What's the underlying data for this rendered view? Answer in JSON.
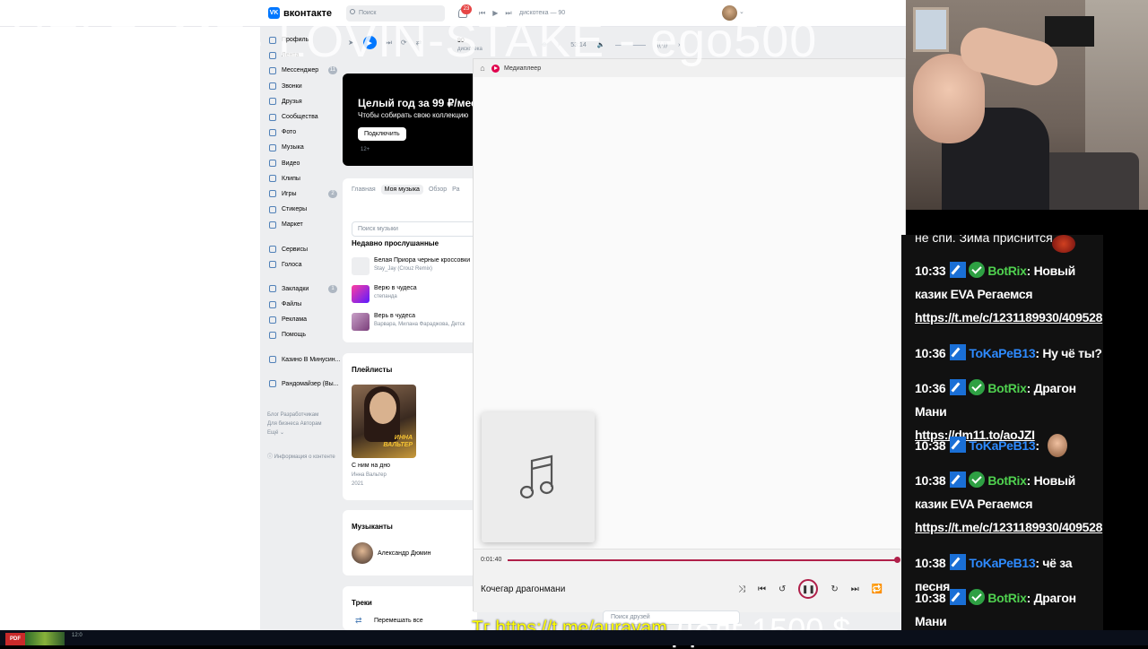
{
  "vk": {
    "brand": "вконтакте",
    "search_placeholder": "Поиск",
    "notif_count": "23",
    "mini_track": "дискотека — 90",
    "nav": [
      {
        "label": "Профиль",
        "badge": ""
      },
      {
        "label": "Лента",
        "badge": ""
      },
      {
        "label": "Мессенджер",
        "badge": "11"
      },
      {
        "label": "Звонки",
        "badge": ""
      },
      {
        "label": "Друзья",
        "badge": ""
      },
      {
        "label": "Сообщества",
        "badge": ""
      },
      {
        "label": "Фото",
        "badge": ""
      },
      {
        "label": "Музыка",
        "badge": ""
      },
      {
        "label": "Видео",
        "badge": ""
      },
      {
        "label": "Клипы",
        "badge": ""
      },
      {
        "label": "Игры",
        "badge": "2"
      },
      {
        "label": "Стикеры",
        "badge": ""
      },
      {
        "label": "Маркет",
        "badge": ""
      },
      {
        "label": "Сервисы",
        "badge": ""
      },
      {
        "label": "Голоса",
        "badge": ""
      },
      {
        "label": "Закладки",
        "badge": "1"
      },
      {
        "label": "Файлы",
        "badge": ""
      },
      {
        "label": "Реклама",
        "badge": ""
      },
      {
        "label": "Помощь",
        "badge": ""
      },
      {
        "label": "Казино В Минусин...",
        "badge": ""
      },
      {
        "label": "Рандомайзер (Вы...",
        "badge": ""
      }
    ],
    "footer": [
      "Блог  Разработчикам",
      "Для бизнеса  Авторам",
      "Ещё ⌄"
    ],
    "info": "Информация о контенте",
    "player": {
      "track_top": "90",
      "track_artist": "дискотека",
      "time": "53:14"
    },
    "promo": {
      "title": "Целый год за 99 ₽/мес",
      "subtitle": "Чтобы собирать свою коллекцию",
      "button": "Подключить",
      "age": "12+"
    },
    "music": {
      "tabs": [
        "Главная",
        "Моя музыка",
        "Обзор",
        "Ра"
      ],
      "search_placeholder": "Поиск музыки",
      "recent_title": "Недавно прослушанные",
      "recent": [
        {
          "title": "Белая Приора черные кроссовки",
          "artist": "Stay_Jay (Crouz Remix)"
        },
        {
          "title": "Верю в чудеса",
          "artist": "степанда"
        },
        {
          "title": "Верь в чудеса",
          "artist": "Варвара, Милана Фараджова, Детск"
        }
      ],
      "playlists_title": "Плейлисты",
      "playlist": {
        "cover_text_1": "ИННА",
        "cover_text_2": "ВАЛЬТЕР",
        "title": "С ним на дно",
        "artist": "Инна Вальтер",
        "year": "2021"
      },
      "musicians_title": "Музыканты",
      "musician": "Александр Дюмин",
      "tracks_title": "Треки",
      "shuffle_label": "Перемешать все"
    },
    "friends_search": "Поиск друзей"
  },
  "media_player": {
    "app_name": "Медиаплеер",
    "elapsed": "0:01:40",
    "progress_fraction": 0.99,
    "song_title": "Кочегар драгонмани",
    "accent": "#b0204a"
  },
  "overlay": {
    "help_text": "HELP- ME- LOVIN-STAKE - ego500",
    "tg_link": "Тг https://t.me/auravam",
    "debt": "Долг 1500 $"
  },
  "chat": {
    "cut_line": "не спи. Зима приснится",
    "messages": [
      {
        "time": "10:33",
        "user": "BotRix",
        "kind": "bot",
        "text": "Новый казик EVA Регаемся",
        "link": "https://t.me/c/1231189930/409528"
      },
      {
        "time": "10:36",
        "user": "ToKaPeB13",
        "kind": "user",
        "text": "Ну чё ты?",
        "link": ""
      },
      {
        "time": "10:36",
        "user": "BotRix",
        "kind": "bot",
        "text": "Драгон Мани",
        "link": "https://dm11.to/aoJZI"
      },
      {
        "time": "10:38",
        "user": "ToKaPeB13",
        "kind": "user",
        "text": "",
        "link": ""
      },
      {
        "time": "10:38",
        "user": "BotRix",
        "kind": "bot",
        "text": "Новый казик EVA Регаемся",
        "link": "https://t.me/c/1231189930/409528"
      },
      {
        "time": "10:38",
        "user": "ToKaPeB13",
        "kind": "user",
        "text": "чё за песня",
        "link": ""
      },
      {
        "time": "10:38",
        "user": "BotRix",
        "kind": "bot",
        "text": "Драгон Мани",
        "link": "https://dm11.to/aoJZI"
      }
    ]
  },
  "taskbar": {
    "pdf_label": "PDF",
    "misc": "12:0"
  }
}
